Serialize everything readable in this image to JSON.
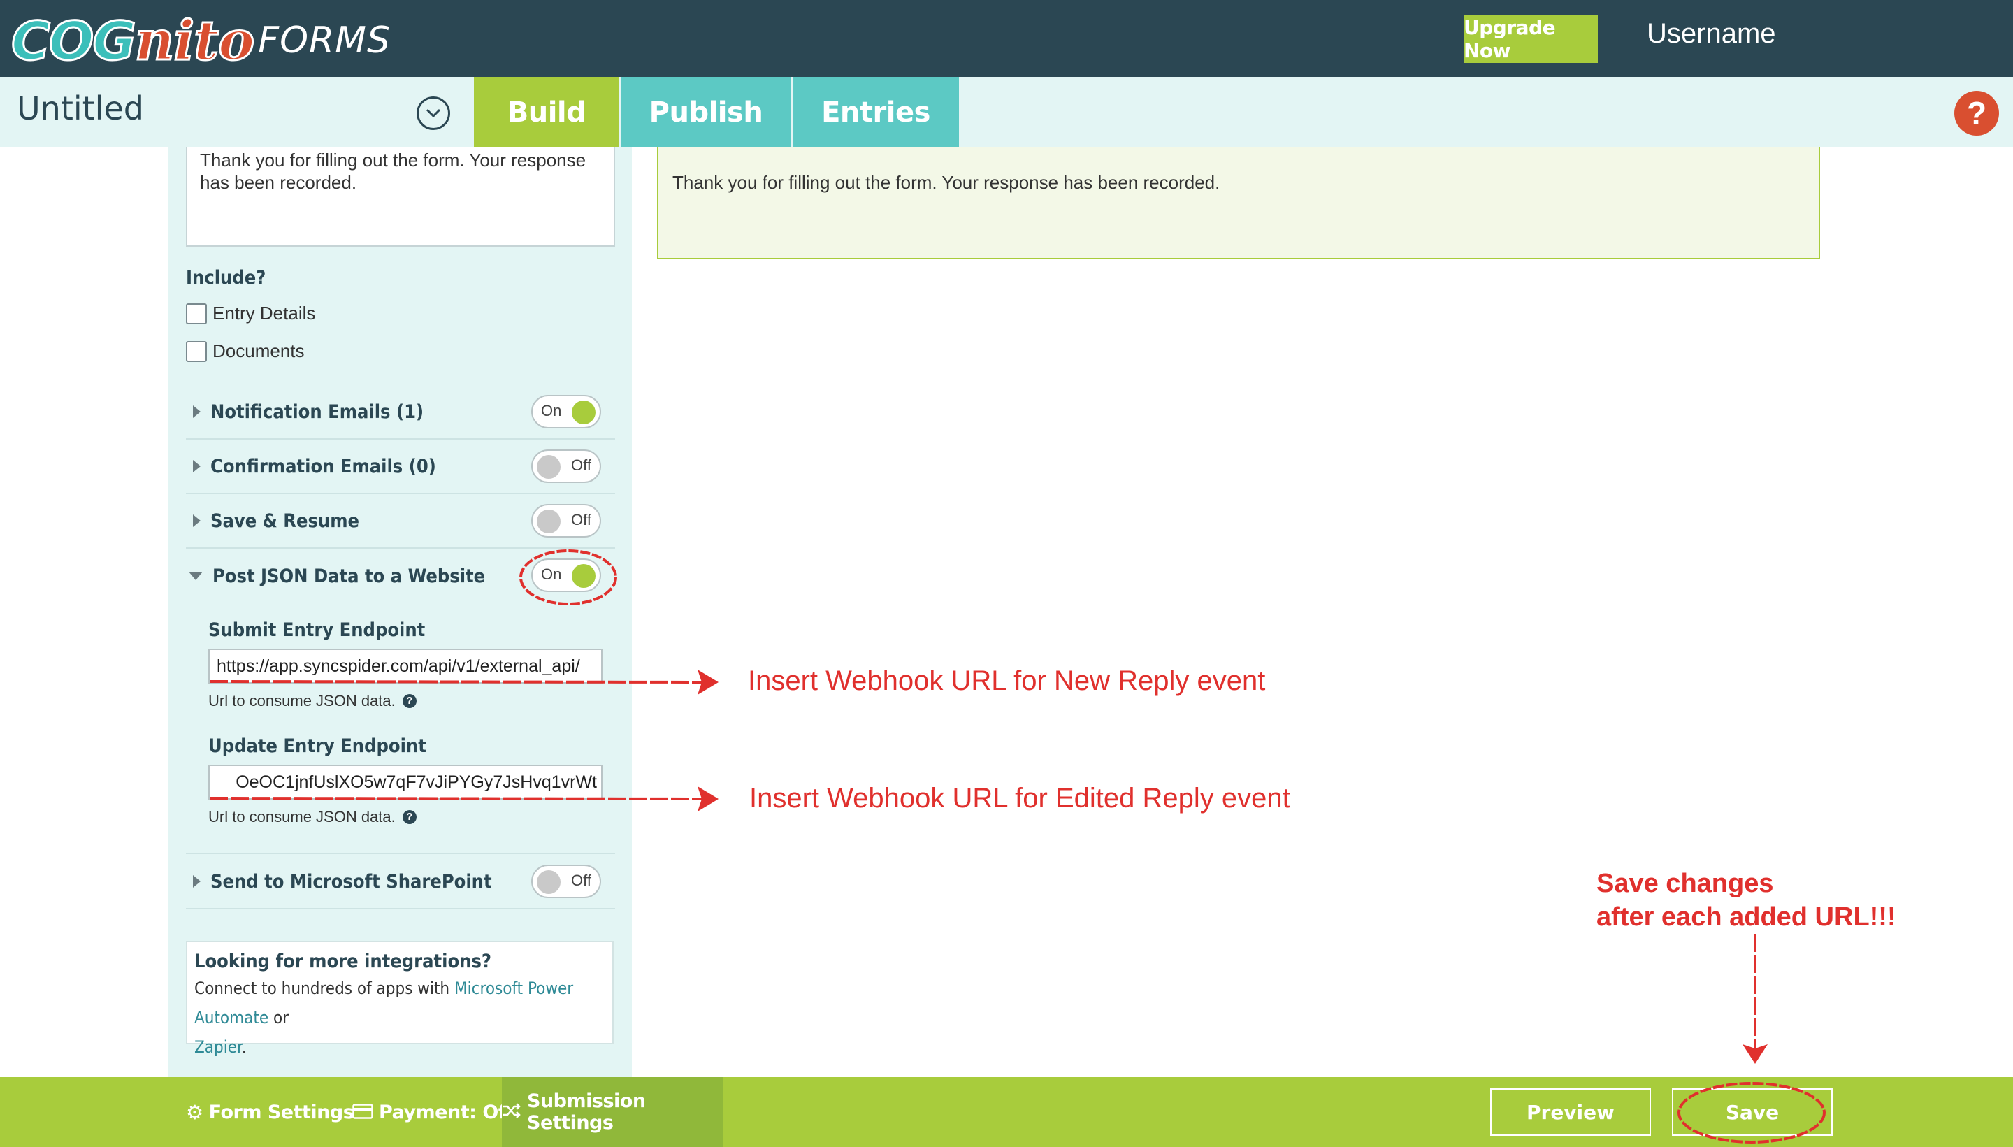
{
  "header": {
    "logo_cog": "COG",
    "logo_nito": "nito",
    "logo_forms": "FORMS",
    "upgrade_label": "Upgrade Now",
    "username": "Username"
  },
  "nav": {
    "form_title": "Untitled",
    "tabs": [
      {
        "label": "Build",
        "active": true
      },
      {
        "label": "Publish",
        "active": false
      },
      {
        "label": "Entries",
        "active": false
      }
    ],
    "help_label": "?"
  },
  "panel": {
    "message_text": "Thank you for filling out the form. Your response has been recorded.",
    "include_label": "Include?",
    "include_options": [
      {
        "label": "Entry Details",
        "checked": false
      },
      {
        "label": "Documents",
        "checked": false
      }
    ],
    "sections": [
      {
        "label": "Notification Emails (1)",
        "toggle": "On",
        "expanded": false
      },
      {
        "label": "Confirmation Emails (0)",
        "toggle": "Off",
        "expanded": false
      },
      {
        "label": "Save & Resume",
        "toggle": "Off",
        "expanded": false
      },
      {
        "label": "Post JSON Data to a Website",
        "toggle": "On",
        "expanded": true
      },
      {
        "label": "Send to Microsoft SharePoint",
        "toggle": "Off",
        "expanded": false
      }
    ],
    "submit_endpoint": {
      "label": "Submit Entry Endpoint",
      "value": "https://app.syncspider.com/api/v1/external_api/",
      "help": "Url to consume JSON data."
    },
    "update_endpoint": {
      "label": "Update Entry Endpoint",
      "value": "OeOC1jnfUslXO5w7qF7vJiPYGy7JsHvq1vrWt",
      "help": "Url to consume JSON data."
    },
    "integrations": {
      "title": "Looking for more integrations?",
      "body_prefix": "Connect to hundreds of apps with ",
      "link1": "Microsoft Power Automate",
      "body_mid": " or",
      "link2": "Zapier",
      "body_suffix": "."
    }
  },
  "preview": {
    "confirmation_text": "Thank you for filling out the form. Your response has been recorded."
  },
  "annotations": {
    "new_reply": "Insert Webhook URL for New Reply event",
    "edited_reply": "Insert Webhook URL for Edited Reply event",
    "save_line1": "Save changes",
    "save_line2": "after each added URL!!!"
  },
  "footer": {
    "form_settings": "Form Settings",
    "payment": "Payment: Off",
    "submission_settings": "Submission Settings",
    "preview": "Preview",
    "save": "Save"
  },
  "colors": {
    "header_bg": "#2b4753",
    "accent_green": "#a8cc3c",
    "accent_teal": "#5cc9c4",
    "annotation_red": "#e0302d"
  }
}
